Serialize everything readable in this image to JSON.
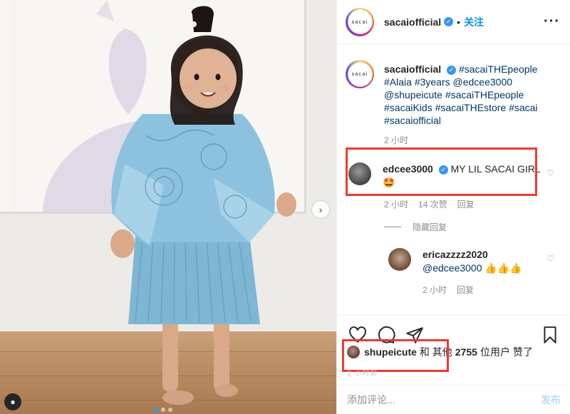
{
  "post": {
    "username": "sacaiofficial",
    "follow_separator": "•",
    "follow_label": "关注",
    "more_icon": "more-horizontal-icon",
    "avatar_text": "sacai"
  },
  "caption": {
    "username": "sacaiofficial",
    "segments": [
      {
        "text": "#sacaiTHEpeople",
        "type": "tag"
      },
      {
        "text": "#Alaia",
        "type": "tag"
      },
      {
        "text": "#3years",
        "type": "tag"
      },
      {
        "text": "@edcee3000",
        "type": "tag"
      },
      {
        "text": "@shupeicute",
        "type": "tag"
      },
      {
        "text": "#sacaiTHEpeople",
        "type": "tag"
      },
      {
        "text": "#sacaiKids",
        "type": "tag"
      },
      {
        "text": "#sacaiTHEstore",
        "type": "tag"
      },
      {
        "text": "#sacai",
        "type": "tag"
      },
      {
        "text": "#sacaiofficial",
        "type": "tag"
      }
    ],
    "time": "2 小时"
  },
  "comments": [
    {
      "username": "edcee3000",
      "verified": true,
      "text": "MY LIL SACAI GIRL",
      "emoji": "🤩",
      "time": "2 小时",
      "likes": "14 次赞",
      "reply": "回复",
      "hide_replies": "隐藏回复"
    },
    {
      "username": "ericazzzz2020",
      "verified": false,
      "text": "@edcee3000",
      "emoji": "👍👍👍",
      "time": "2 小时",
      "reply": "回复"
    }
  ],
  "actions": {
    "like_icon": "heart-icon",
    "comment_icon": "comment-icon",
    "share_icon": "share-icon",
    "save_icon": "bookmark-icon"
  },
  "likes": {
    "username": "shupeicute",
    "connector": "和 其他",
    "count": "2755",
    "suffix": "位用户 赞了"
  },
  "faded_time": "2 小时前",
  "add_comment": {
    "placeholder": "添加评论...",
    "post_label": "发布"
  },
  "colors": {
    "highlight_box": "#ee3b2f",
    "link": "#00376b",
    "follow": "#0095f6",
    "verified": "#3897f0"
  }
}
